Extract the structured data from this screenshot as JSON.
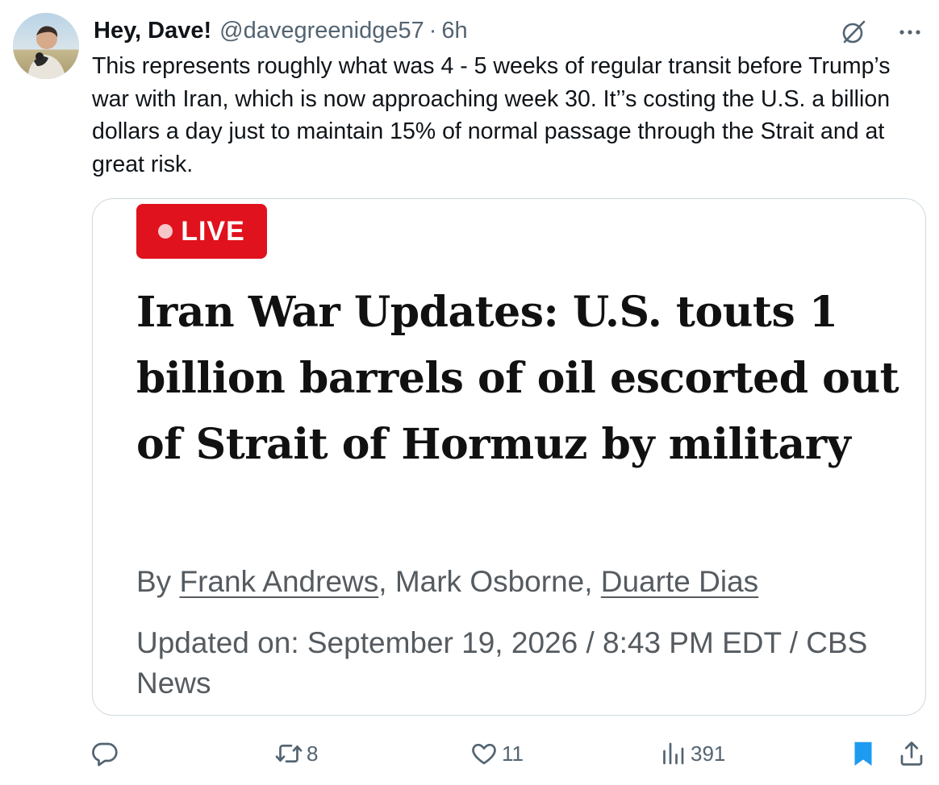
{
  "tweet": {
    "author": {
      "display_name": "Hey, Dave!",
      "handle": "@davegreenidge57",
      "separator": "·",
      "time": "6h"
    },
    "text": "This represents roughly what was 4 - 5 weeks of regular transit before Trump’s war with Iran, which is now approaching week 30. It’’s costing the U.S. a billion dollars a day just to maintain 15% of normal passage through the Strait and at great risk.",
    "media": {
      "live_label": "LIVE",
      "headline": "Iran War Updates: U.S. touts 1 billion barrels of oil escorted out of Strait of Hormuz by military",
      "byline": {
        "prefix": "By ",
        "authors": [
          "Frank Andrews",
          "Mark Osborne",
          "Duarte Dias"
        ],
        "separator": ", "
      },
      "updated": "Updated on: September 19, 2026 / 8:43 PM EDT / CBS News"
    },
    "actions": {
      "reply_count": "",
      "retweet_count": "8",
      "like_count": "11",
      "views_count": "391"
    },
    "icons": {
      "reply": "reply-icon",
      "retweet": "retweet-icon",
      "like": "heart-icon",
      "views": "views-icon",
      "bookmark": "bookmark-icon",
      "share": "share-icon",
      "grok": "grok-icon",
      "more": "more-icon"
    },
    "colors": {
      "live_red": "#e0121d",
      "bookmark_blue": "#1d9bf0",
      "muted": "#536471"
    }
  }
}
